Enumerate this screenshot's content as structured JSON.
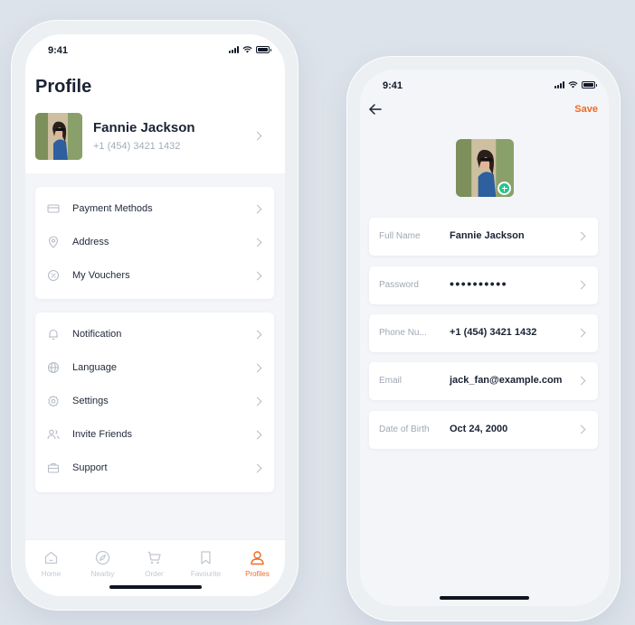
{
  "status_bar": {
    "time": "9:41"
  },
  "profile_screen": {
    "title": "Profile",
    "user": {
      "name": "Fannie Jackson",
      "phone": "+1 (454) 3421 1432"
    },
    "group1": [
      {
        "label": "Payment Methods",
        "icon": "credit-card-icon"
      },
      {
        "label": "Address",
        "icon": "location-pin-icon"
      },
      {
        "label": "My Vouchers",
        "icon": "voucher-icon"
      }
    ],
    "group2": [
      {
        "label": "Notification",
        "icon": "bell-icon"
      },
      {
        "label": "Language",
        "icon": "globe-icon"
      },
      {
        "label": "Settings",
        "icon": "gear-icon"
      },
      {
        "label": "Invite Friends",
        "icon": "users-icon"
      },
      {
        "label": "Support",
        "icon": "briefcase-icon"
      }
    ],
    "tabs": [
      {
        "label": "Home",
        "icon": "home-icon",
        "active": false
      },
      {
        "label": "Nearby",
        "icon": "compass-icon",
        "active": false
      },
      {
        "label": "Order",
        "icon": "cart-icon",
        "active": false
      },
      {
        "label": "Favourite",
        "icon": "bookmark-icon",
        "active": false
      },
      {
        "label": "Profiles",
        "icon": "user-icon",
        "active": true
      }
    ]
  },
  "edit_screen": {
    "save_label": "Save",
    "fields": [
      {
        "label": "Full Name",
        "value": "Fannie Jackson"
      },
      {
        "label": "Password",
        "value": "••••••••••"
      },
      {
        "label": "Phone Nu...",
        "value": "+1 (454) 3421 1432"
      },
      {
        "label": "Email",
        "value": "jack_fan@example.com"
      },
      {
        "label": "Date of Birth",
        "value": "Oct 24, 2000"
      }
    ]
  },
  "colors": {
    "accent": "#f26a23",
    "badge_green": "#22c78a",
    "text_primary": "#1a2233",
    "text_muted": "#a4abb8"
  }
}
